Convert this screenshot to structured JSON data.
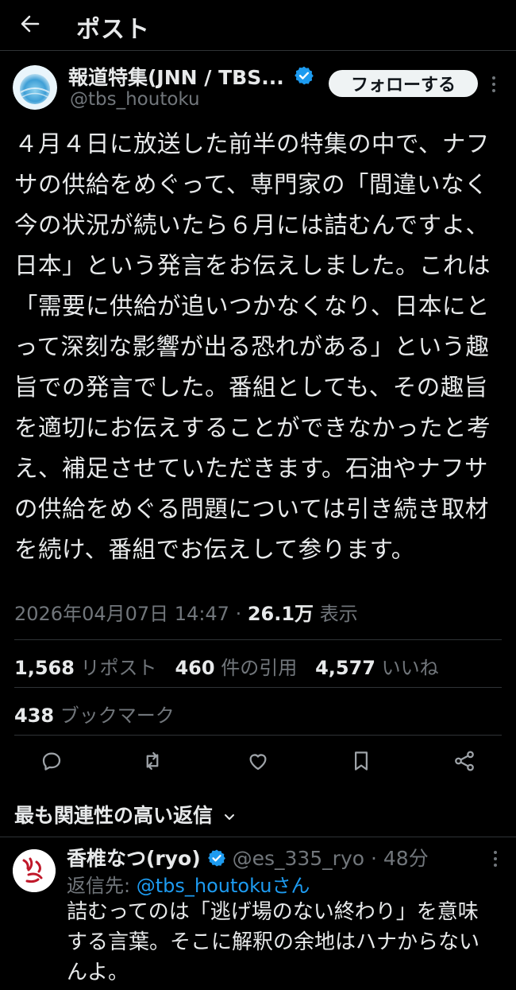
{
  "header": {
    "title": "ポスト",
    "back_icon": "arrow-left-icon"
  },
  "author": {
    "display_name": "報道特集(JNN / TBS...",
    "handle": "@tbs_houtoku",
    "avatar_text": "報道特集",
    "verified": true
  },
  "follow_label": "フォローする",
  "post": {
    "text": "４月４日に放送した前半の特集の中で、ナフサの供給をめぐって、専門家の「間違いなく今の状況が続いたら６月には詰むんですよ、日本」という発言をお伝えしました。これは「需要に供給が追いつかなくなり、日本にとって深刻な影響が出る恐れがある」という趣旨での発言でした。番組としても、その趣旨を適切にお伝えすることができなかったと考え、補足させていただきます。石油やナフサの供給をめぐる問題については引き続き取材を続け、番組でお伝えして参ります。",
    "timestamp": "2026年04月07日 14:47",
    "separator": " · ",
    "views_count": "26.1万",
    "views_label": " 表示"
  },
  "stats": {
    "reposts_count": "1,568",
    "reposts_label": " リポスト",
    "quotes_count": "460",
    "quotes_label": " 件の引用",
    "likes_count": "4,577",
    "likes_label": " いいね",
    "bookmarks_count": "438",
    "bookmarks_label": " ブックマーク"
  },
  "actions": [
    "reply-icon",
    "repost-icon",
    "like-icon",
    "bookmark-icon",
    "share-icon"
  ],
  "sort_label": "最も関連性の高い返信",
  "reply": {
    "display_name": "香椎なつ(ryo)",
    "handle": "@es_335_ryo",
    "time": "48分",
    "separator": " · ",
    "reply_to_prefix": "返信先: ",
    "reply_to_handle": "@tbs_houtokuさん",
    "text": "詰むってのは「逃げ場のない終わり」を意味する言葉。そこに解釈の余地はハナからないんよ。"
  },
  "colors": {
    "background": "#000000",
    "text": "#e7e9ea",
    "muted": "#71767b",
    "accent": "#1d9bf0",
    "divider": "#2f3336"
  }
}
